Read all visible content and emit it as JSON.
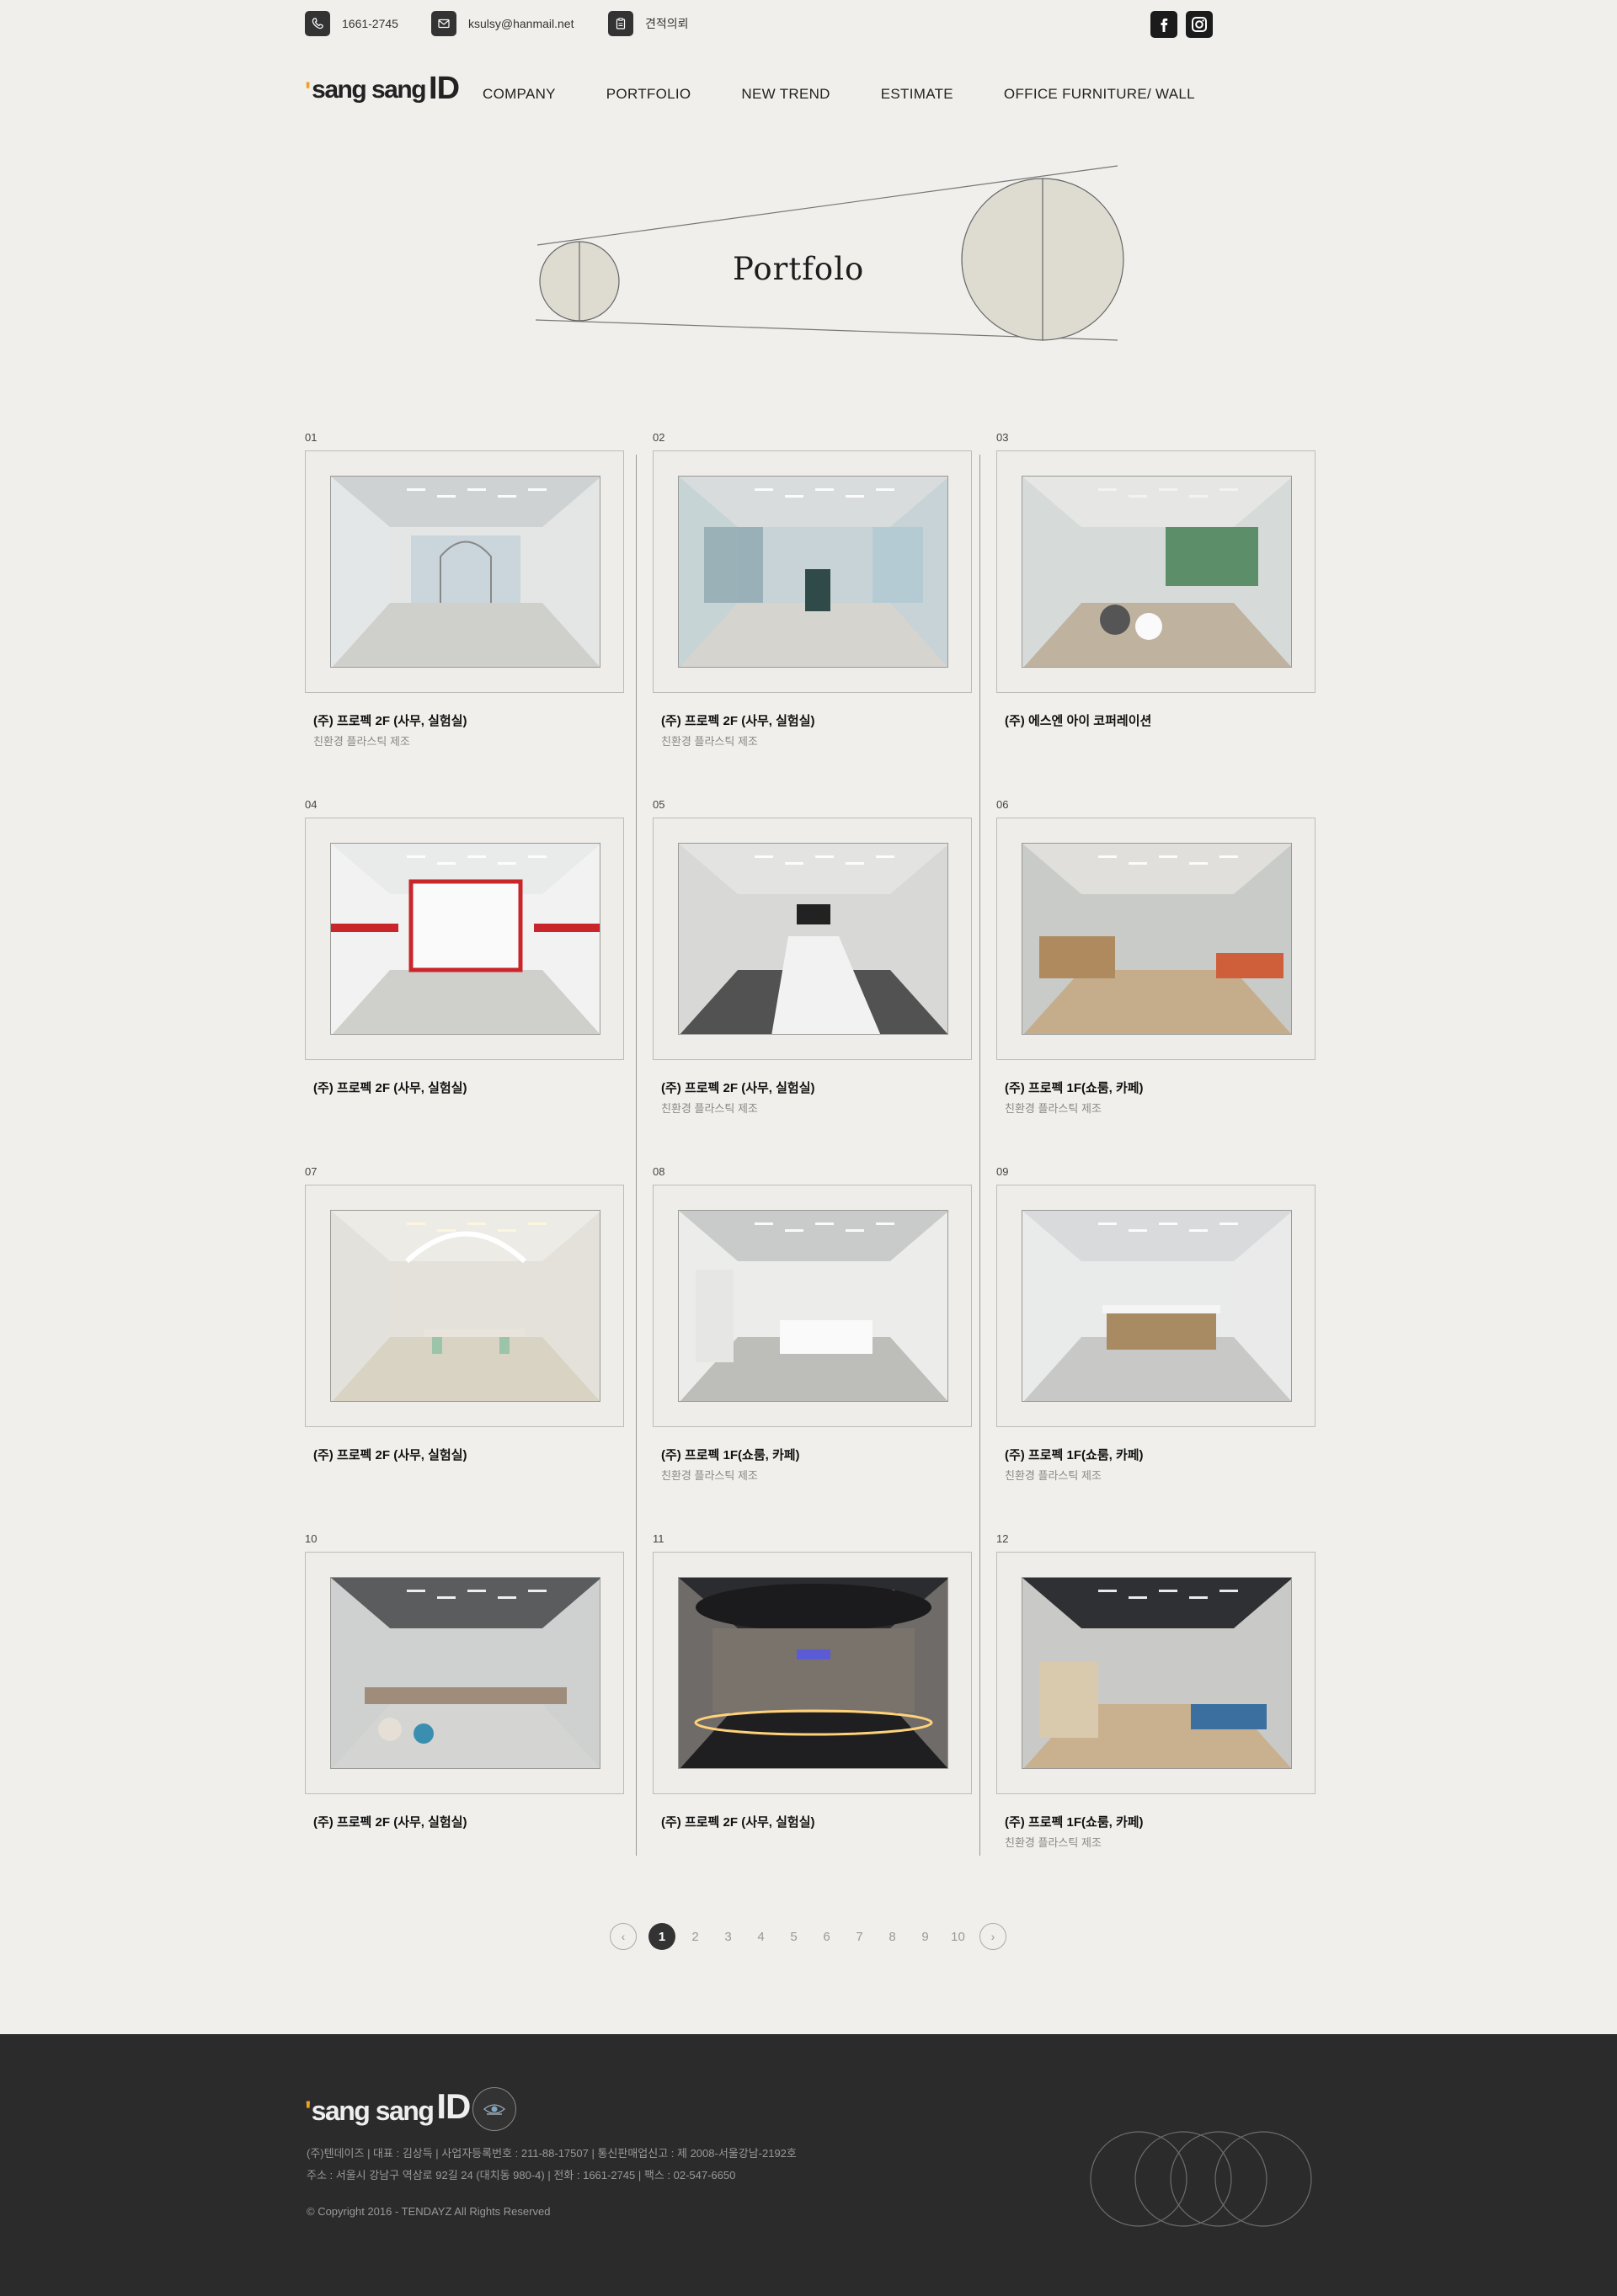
{
  "topbar": {
    "phone": "1661-2745",
    "email": "ksulsy@hanmail.net",
    "estimate": "견적의뢰"
  },
  "header": {
    "logo_quote": "'",
    "logo_word": "sang sang",
    "logo_id": "ID",
    "nav": [
      "COMPANY",
      "PORTFOLIO",
      "NEW TREND",
      "ESTIMATE",
      "OFFICE FURNITURE/ WALL"
    ]
  },
  "hero": {
    "title": "Portfolo"
  },
  "portfolio": [
    {
      "num": "01",
      "title": "(주) 프로펙 2F (사무, 실험실)",
      "sub": "친환경 플라스틱 제조",
      "scene": "glass"
    },
    {
      "num": "02",
      "title": "(주) 프로펙 2F (사무, 실험실)",
      "sub": "친환경 플라스틱 제조",
      "scene": "lobby"
    },
    {
      "num": "03",
      "title": "(주) 에스엔 아이 코퍼레이션",
      "sub": "",
      "scene": "lounge"
    },
    {
      "num": "04",
      "title": "(주) 프로펙 2F (사무, 실험실)",
      "sub": "",
      "scene": "redwall"
    },
    {
      "num": "05",
      "title": "(주) 프로펙 2F (사무, 실험실)",
      "sub": "친환경 플라스틱 제조",
      "scene": "meeting"
    },
    {
      "num": "06",
      "title": "(주) 프로펙 1F(쇼룸, 카페)",
      "sub": "친환경 플라스틱 제조",
      "scene": "cafe"
    },
    {
      "num": "07",
      "title": "(주) 프로펙 2F (사무, 실험실)",
      "sub": "",
      "scene": "canteen"
    },
    {
      "num": "08",
      "title": "(주) 프로펙 1F(쇼룸, 카페)",
      "sub": "친환경 플라스틱 제조",
      "scene": "kitchen"
    },
    {
      "num": "09",
      "title": "(주) 프로펙 1F(쇼룸, 카페)",
      "sub": "친환경 플라스틱 제조",
      "scene": "bar"
    },
    {
      "num": "10",
      "title": "(주) 프로펙 2F (사무, 실험실)",
      "sub": "",
      "scene": "openoffice"
    },
    {
      "num": "11",
      "title": "(주) 프로펙 2F (사무, 실험실)",
      "sub": "",
      "scene": "showroom"
    },
    {
      "num": "12",
      "title": "(주) 프로펙 1F(쇼룸, 카페)",
      "sub": "친환경 플라스틱 제조",
      "scene": "billiard"
    }
  ],
  "pagination": {
    "prev": "‹",
    "next": "›",
    "pages": [
      "1",
      "2",
      "3",
      "4",
      "5",
      "6",
      "7",
      "8",
      "9",
      "10"
    ],
    "current": "1"
  },
  "footer": {
    "logo_quote": "'",
    "logo_word": "sang sang",
    "logo_id": "ID",
    "line1": "(주)텐데이즈 | 대표 : 김상득 | 사업자등록번호 : 211-88-17507 | 통신판매업신고 : 제 2008-서울강남-2192호",
    "line2": "주소 : 서울시 강남구 역삼로 92길 24 (대치동 980-4) | 전화 : 1661-2745 | 팩스 : 02-547-6650",
    "copyright": "© Copyright 2016 - TENDAYZ All Rights Reserved"
  },
  "colors": {
    "background": "#f0efeb",
    "footer": "#2b2b2b",
    "accent": "#f0a023"
  },
  "icons": [
    "phone-icon",
    "mail-icon",
    "clipboard-icon",
    "facebook-icon",
    "instagram-icon"
  ]
}
